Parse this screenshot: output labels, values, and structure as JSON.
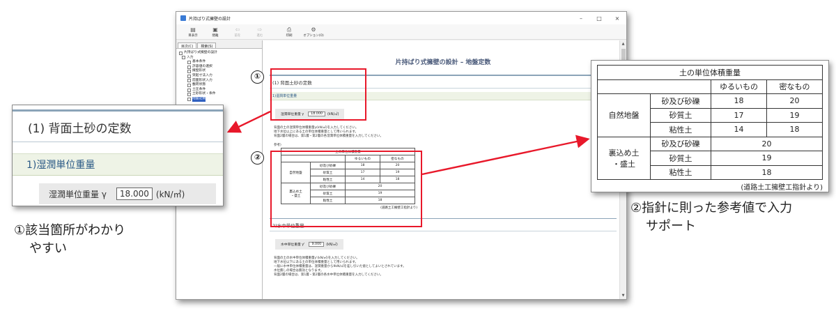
{
  "window": {
    "title": "片持ばり式擁壁の設計",
    "controls": [
      "–",
      "□",
      "×"
    ]
  },
  "toolbar": {
    "items": [
      {
        "label": "目表示",
        "icon": "▤",
        "enabled": true
      },
      {
        "label": "閉離",
        "icon": "▣",
        "enabled": true
      },
      {
        "label": "前を",
        "icon": "⇦",
        "enabled": false
      },
      {
        "label": "進む",
        "icon": "⇨",
        "enabled": false
      },
      {
        "label": "印刷",
        "icon": "⎙",
        "enabled": true
      },
      {
        "label": "オプション(O)",
        "icon": "⚙",
        "enabled": true
      }
    ]
  },
  "tree": {
    "tabs": [
      "目次(C)",
      "検索(S)"
    ],
    "items": [
      {
        "label": "片持ばり式擁壁の設計",
        "level": 0
      },
      {
        "label": "入力",
        "level": 0
      },
      {
        "label": "基本条件",
        "level": 2
      },
      {
        "label": "許容値の選択",
        "level": 2
      },
      {
        "label": "擁壁形状",
        "level": 2
      },
      {
        "label": "突起寸法入力",
        "level": 2
      },
      {
        "label": "前面形状入力",
        "level": 2
      },
      {
        "label": "載荷状態",
        "level": 2
      },
      {
        "label": "土圧条件",
        "level": 2
      },
      {
        "label": "土砂形状・条件",
        "level": 2
      },
      {
        "label": "地盤定数",
        "level": 2,
        "selected": true
      }
    ]
  },
  "doc": {
    "title": "片持ばり式擁壁の設計 – 地盤定数",
    "section1": "(1) 背面土砂の定数",
    "sub1": "1)湿潤単位重量",
    "field1_label": "湿潤単位重量 γ",
    "field1_value": "18.000",
    "field1_unit": "(kN/㎥)",
    "desc1": [
      "背面の土の湿潤単位体積重量γ(kN/㎥)を入力してください。",
      "地下水位以上にある土の単位体積重量として用いられます。",
      "背面2層の場合は、第1層・第2層の各湿潤単位体積重量を入力してください。"
    ],
    "ref_label": "参考)",
    "sub2": "2)水中単位重量",
    "field2_label": "水中単位重量 γ'",
    "field2_value": "9.000",
    "field2_unit": "(kN/㎥)",
    "desc2": [
      "背面の土の水中単位体積重量γ'(kN/㎥)を入力してください。",
      "地下水位以下にある土の単位体積重量として用いられます。",
      "一般に水中単位体積重量は、湿潤重量から9kN/㎥を差し引いた値としてよいとされています。",
      "水位無しの場合は無効となります。",
      "背面2層の場合は、第1層・第2層の各水中単位体積重量を入力してください。"
    ]
  },
  "soil_table": {
    "title": "土の単位体積重量",
    "col_loose": "ゆるいもの",
    "col_dense": "密なもの",
    "group_natural": "自然地盤",
    "group_fill": "裏込め土・盛土",
    "group_fill_line1": "裏込め土",
    "group_fill_line2": "・盛土",
    "natural": [
      {
        "soil": "砂及び砂礫",
        "loose": "18",
        "dense": "20"
      },
      {
        "soil": "砂質土",
        "loose": "17",
        "dense": "19"
      },
      {
        "soil": "粘性土",
        "loose": "14",
        "dense": "18"
      }
    ],
    "fill": [
      {
        "soil": "砂及び砂礫",
        "value": "20"
      },
      {
        "soil": "砂質土",
        "value": "19"
      },
      {
        "soil": "粘性土",
        "value": "18"
      }
    ],
    "note": "(道路土工擁壁工指針より)"
  },
  "callouts": {
    "num1": "①",
    "num2": "②",
    "caption_left_line1": "①該当箇所がわかり",
    "caption_left_line2": "やすい",
    "caption_right_line1": "②指針に則った参考値で入力",
    "caption_right_line2": "サポート"
  },
  "colors": {
    "highlight": "#e8182a",
    "section_rule": "#8ba4b8",
    "subsection_bg": "#eef3e6",
    "subsection_text": "#2b5a86"
  }
}
